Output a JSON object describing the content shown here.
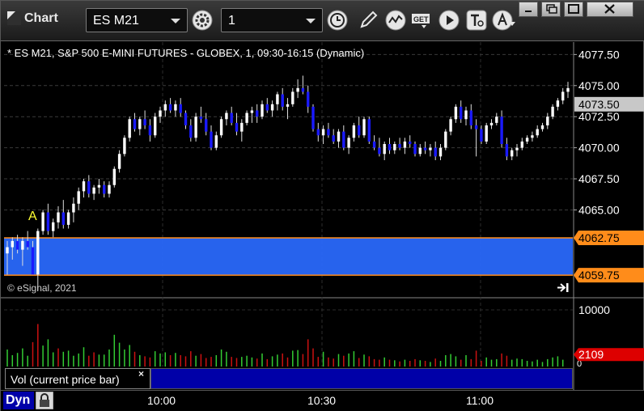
{
  "toolbar": {
    "title": "Chart",
    "symbol": "ES M21",
    "interval": "1",
    "icons": [
      "gear-icon",
      "clock-icon",
      "pencil-icon",
      "study-icon",
      "get-icon",
      "play-icon",
      "text-tool-icon",
      "alert-icon"
    ],
    "window_buttons": [
      "restore-icon",
      "maximize-icon",
      "close-icon"
    ]
  },
  "chart": {
    "title": "* ES M21, S&P 500 E-MINI FUTURES - GLOBEX, 1, 09:30-16:15 (Dynamic)",
    "watermark": "© eSignal, 2021",
    "marker_label": "A",
    "price_ticks": [
      "4077.50",
      "4075.00",
      "4072.50",
      "4070.00",
      "4067.50",
      "4065.00"
    ],
    "last_price": "4073.50",
    "band_high": "4062.75",
    "band_low": "4059.75",
    "volume_ticks": [
      "10000",
      "0"
    ],
    "volume_last": "2109",
    "volume_legend": "Vol (current price bar)",
    "time_labels": [
      "10:00",
      "10:30",
      "11:00"
    ],
    "dyn_label": "Dyn",
    "colors": {
      "up_candle": "#ffffff",
      "down_candle": "#1a1aff",
      "band_fill": "#2a6bff",
      "band_edge": "#ff8c1a",
      "vol_up": "#33cc33",
      "vol_down": "#cc1111",
      "last_price_bg": "#c8c8c8",
      "vol_last_bg": "#dd0000"
    }
  },
  "chart_data": {
    "type": "candlestick",
    "title": "* ES M21, S&P 500 E-MINI FUTURES - GLOBEX, 1, 09:30-16:15 (Dynamic)",
    "ylim": [
      4058.0,
      4078.5
    ],
    "x_ticks": [
      "10:00",
      "10:30",
      "11:00"
    ],
    "band": [
      4059.75,
      4062.75
    ],
    "candles": [
      [
        4061.5,
        4062.5,
        4059.8,
        4062.0
      ],
      [
        4062.0,
        4062.8,
        4061.0,
        4062.5
      ],
      [
        4062.5,
        4063.0,
        4061.5,
        4061.8
      ],
      [
        4061.8,
        4062.8,
        4060.5,
        4062.5
      ],
      [
        4062.5,
        4063.3,
        4061.8,
        4062.0
      ],
      [
        4062.0,
        4062.5,
        4059.8,
        4059.8
      ],
      [
        4059.8,
        4063.5,
        4058.5,
        4063.3
      ],
      [
        4063.3,
        4065.0,
        4063.0,
        4064.8
      ],
      [
        4064.8,
        4065.5,
        4063.0,
        4063.3
      ],
      [
        4063.3,
        4064.3,
        4062.8,
        4064.0
      ],
      [
        4064.0,
        4065.3,
        4063.5,
        4064.8
      ],
      [
        4064.8,
        4065.8,
        4063.5,
        4063.8
      ],
      [
        4063.8,
        4065.0,
        4063.5,
        4064.8
      ],
      [
        4064.8,
        4066.0,
        4064.0,
        4065.5
      ],
      [
        4065.5,
        4066.8,
        4065.0,
        4066.5
      ],
      [
        4066.5,
        4067.5,
        4066.0,
        4067.3
      ],
      [
        4067.3,
        4067.8,
        4066.0,
        4066.3
      ],
      [
        4066.3,
        4067.0,
        4065.8,
        4066.8
      ],
      [
        4066.8,
        4067.5,
        4066.3,
        4067.0
      ],
      [
        4067.0,
        4067.3,
        4066.0,
        4066.3
      ],
      [
        4066.3,
        4067.3,
        4066.0,
        4067.0
      ],
      [
        4067.0,
        4068.5,
        4066.8,
        4068.3
      ],
      [
        4068.3,
        4069.8,
        4068.0,
        4069.5
      ],
      [
        4069.5,
        4071.0,
        4069.3,
        4070.8
      ],
      [
        4070.8,
        4072.5,
        4070.5,
        4072.3
      ],
      [
        4072.3,
        4072.8,
        4071.3,
        4071.5
      ],
      [
        4071.5,
        4072.5,
        4071.0,
        4072.3
      ],
      [
        4072.3,
        4073.0,
        4071.5,
        4071.8
      ],
      [
        4071.8,
        4072.3,
        4070.5,
        4071.0
      ],
      [
        4071.0,
        4072.8,
        4070.8,
        4072.5
      ],
      [
        4072.5,
        4073.3,
        4072.0,
        4073.0
      ],
      [
        4073.0,
        4073.8,
        4072.5,
        4073.5
      ],
      [
        4073.5,
        4074.0,
        4072.8,
        4073.0
      ],
      [
        4073.0,
        4073.8,
        4072.5,
        4073.5
      ],
      [
        4073.5,
        4074.0,
        4072.5,
        4072.8
      ],
      [
        4072.8,
        4073.0,
        4071.5,
        4071.8
      ],
      [
        4071.8,
        4072.3,
        4070.5,
        4070.8
      ],
      [
        4070.8,
        4072.8,
        4070.5,
        4072.5
      ],
      [
        4072.5,
        4073.3,
        4072.0,
        4072.3
      ],
      [
        4072.3,
        4072.8,
        4071.0,
        4071.3
      ],
      [
        4071.3,
        4071.8,
        4069.8,
        4070.0
      ],
      [
        4070.0,
        4071.3,
        4069.8,
        4071.0
      ],
      [
        4071.0,
        4072.5,
        4070.8,
        4072.3
      ],
      [
        4072.3,
        4073.0,
        4071.8,
        4072.8
      ],
      [
        4072.8,
        4073.3,
        4071.8,
        4072.0
      ],
      [
        4072.0,
        4072.8,
        4071.0,
        4071.3
      ],
      [
        4071.3,
        4072.3,
        4070.5,
        4072.0
      ],
      [
        4072.0,
        4073.0,
        4071.8,
        4072.8
      ],
      [
        4072.8,
        4073.3,
        4072.0,
        4073.0
      ],
      [
        4073.0,
        4073.5,
        4072.0,
        4072.5
      ],
      [
        4072.5,
        4073.8,
        4072.3,
        4073.5
      ],
      [
        4073.5,
        4074.0,
        4072.8,
        4073.0
      ],
      [
        4073.0,
        4073.8,
        4072.5,
        4073.5
      ],
      [
        4073.5,
        4074.5,
        4073.0,
        4074.3
      ],
      [
        4074.3,
        4074.8,
        4073.0,
        4073.3
      ],
      [
        4073.3,
        4074.0,
        4072.3,
        4073.5
      ],
      [
        4073.5,
        4074.8,
        4073.3,
        4074.5
      ],
      [
        4074.5,
        4075.5,
        4074.0,
        4074.8
      ],
      [
        4074.8,
        4075.8,
        4074.3,
        4074.5
      ],
      [
        4074.5,
        4075.0,
        4072.8,
        4073.3
      ],
      [
        4073.3,
        4073.5,
        4071.3,
        4071.5
      ],
      [
        4071.5,
        4072.0,
        4070.5,
        4071.0
      ],
      [
        4071.0,
        4071.8,
        4070.3,
        4071.5
      ],
      [
        4071.5,
        4072.0,
        4070.8,
        4071.0
      ],
      [
        4071.0,
        4071.5,
        4070.3,
        4070.5
      ],
      [
        4070.5,
        4071.5,
        4070.0,
        4071.3
      ],
      [
        4071.3,
        4071.8,
        4069.8,
        4070.0
      ],
      [
        4070.0,
        4071.0,
        4069.5,
        4070.8
      ],
      [
        4070.8,
        4072.0,
        4070.5,
        4071.8
      ],
      [
        4071.8,
        4072.5,
        4070.8,
        4071.0
      ],
      [
        4071.0,
        4072.5,
        4070.8,
        4072.3
      ],
      [
        4072.3,
        4072.5,
        4070.3,
        4070.5
      ],
      [
        4070.5,
        4071.0,
        4069.8,
        4070.0
      ],
      [
        4070.0,
        4070.8,
        4069.3,
        4069.5
      ],
      [
        4069.5,
        4070.5,
        4069.0,
        4070.3
      ],
      [
        4070.3,
        4070.8,
        4069.5,
        4069.8
      ],
      [
        4069.8,
        4070.5,
        4069.5,
        4070.3
      ],
      [
        4070.3,
        4070.8,
        4069.8,
        4070.0
      ],
      [
        4070.0,
        4070.8,
        4069.5,
        4070.5
      ],
      [
        4070.5,
        4071.0,
        4070.0,
        4070.3
      ],
      [
        4070.3,
        4070.5,
        4069.3,
        4069.5
      ],
      [
        4069.5,
        4070.3,
        4069.3,
        4070.0
      ],
      [
        4070.0,
        4070.5,
        4069.5,
        4069.8
      ],
      [
        4069.8,
        4070.3,
        4069.3,
        4070.0
      ],
      [
        4070.0,
        4070.5,
        4069.0,
        4069.3
      ],
      [
        4069.3,
        4070.3,
        4069.0,
        4070.0
      ],
      [
        4070.0,
        4071.5,
        4069.8,
        4071.3
      ],
      [
        4071.3,
        4072.5,
        4071.0,
        4072.3
      ],
      [
        4072.3,
        4073.5,
        4072.0,
        4073.3
      ],
      [
        4073.3,
        4073.8,
        4072.0,
        4072.3
      ],
      [
        4072.3,
        4073.3,
        4071.8,
        4073.0
      ],
      [
        4073.0,
        4073.5,
        4071.5,
        4071.8
      ],
      [
        4071.8,
        4072.3,
        4069.3,
        4071.5
      ],
      [
        4071.5,
        4071.8,
        4070.3,
        4070.5
      ],
      [
        4070.5,
        4072.0,
        4070.3,
        4071.8
      ],
      [
        4071.8,
        4072.3,
        4071.5,
        4072.0
      ],
      [
        4072.0,
        4072.8,
        4071.8,
        4072.5
      ],
      [
        4072.5,
        4073.0,
        4070.0,
        4070.3
      ],
      [
        4070.3,
        4070.8,
        4069.0,
        4069.3
      ],
      [
        4069.3,
        4070.0,
        4069.0,
        4069.8
      ],
      [
        4069.8,
        4070.3,
        4069.3,
        4070.0
      ],
      [
        4070.0,
        4070.8,
        4069.8,
        4070.5
      ],
      [
        4070.5,
        4071.0,
        4070.3,
        4070.8
      ],
      [
        4070.8,
        4071.3,
        4070.5,
        4071.0
      ],
      [
        4071.0,
        4071.8,
        4070.8,
        4071.5
      ],
      [
        4071.5,
        4072.0,
        4071.3,
        4071.8
      ],
      [
        4071.8,
        4072.8,
        4071.5,
        4072.5
      ],
      [
        4072.5,
        4073.5,
        4072.3,
        4073.3
      ],
      [
        4073.3,
        4074.0,
        4073.0,
        4073.8
      ],
      [
        4073.8,
        4074.8,
        4073.5,
        4074.5
      ],
      [
        4074.5,
        4075.3,
        4074.0,
        4074.8
      ]
    ],
    "volume": [
      [
        3000,
        1
      ],
      [
        2000,
        1
      ],
      [
        2400,
        1
      ],
      [
        3200,
        1
      ],
      [
        1900,
        1
      ],
      [
        4300,
        0
      ],
      [
        7500,
        0
      ],
      [
        3700,
        1
      ],
      [
        4800,
        1
      ],
      [
        2500,
        1
      ],
      [
        3200,
        0
      ],
      [
        2600,
        1
      ],
      [
        2800,
        1
      ],
      [
        1900,
        1
      ],
      [
        2300,
        1
      ],
      [
        3400,
        1
      ],
      [
        1900,
        0
      ],
      [
        2500,
        0
      ],
      [
        2100,
        1
      ],
      [
        2100,
        1
      ],
      [
        3000,
        1
      ],
      [
        5600,
        1
      ],
      [
        4200,
        1
      ],
      [
        3000,
        1
      ],
      [
        3800,
        1
      ],
      [
        2600,
        0
      ],
      [
        2000,
        1
      ],
      [
        1800,
        0
      ],
      [
        1600,
        0
      ],
      [
        2700,
        1
      ],
      [
        2300,
        1
      ],
      [
        2500,
        1
      ],
      [
        2000,
        0
      ],
      [
        2400,
        1
      ],
      [
        2000,
        0
      ],
      [
        1800,
        0
      ],
      [
        2700,
        0
      ],
      [
        1900,
        1
      ],
      [
        2200,
        0
      ],
      [
        1500,
        0
      ],
      [
        1700,
        0
      ],
      [
        2000,
        1
      ],
      [
        3000,
        1
      ],
      [
        2600,
        1
      ],
      [
        1700,
        0
      ],
      [
        1500,
        0
      ],
      [
        1700,
        1
      ],
      [
        1900,
        1
      ],
      [
        1600,
        1
      ],
      [
        1400,
        0
      ],
      [
        2300,
        1
      ],
      [
        1300,
        0
      ],
      [
        1800,
        1
      ],
      [
        2100,
        1
      ],
      [
        2300,
        0
      ],
      [
        1600,
        0
      ],
      [
        2800,
        1
      ],
      [
        2900,
        1
      ],
      [
        2200,
        0
      ],
      [
        4800,
        0
      ],
      [
        3200,
        0
      ],
      [
        1700,
        0
      ],
      [
        2600,
        1
      ],
      [
        1600,
        0
      ],
      [
        1400,
        0
      ],
      [
        2200,
        1
      ],
      [
        1900,
        0
      ],
      [
        2300,
        1
      ],
      [
        2700,
        1
      ],
      [
        1500,
        0
      ],
      [
        2100,
        1
      ],
      [
        1800,
        0
      ],
      [
        1300,
        0
      ],
      [
        1200,
        0
      ],
      [
        1600,
        1
      ],
      [
        1200,
        0
      ],
      [
        1100,
        1
      ],
      [
        900,
        0
      ],
      [
        1200,
        1
      ],
      [
        1000,
        0
      ],
      [
        1300,
        0
      ],
      [
        1100,
        1
      ],
      [
        1000,
        0
      ],
      [
        800,
        1
      ],
      [
        1400,
        0
      ],
      [
        1000,
        1
      ],
      [
        2000,
        1
      ],
      [
        2200,
        1
      ],
      [
        1800,
        1
      ],
      [
        1200,
        0
      ],
      [
        2000,
        1
      ],
      [
        1300,
        0
      ],
      [
        2800,
        0
      ],
      [
        1000,
        0
      ],
      [
        1600,
        1
      ],
      [
        1200,
        1
      ],
      [
        1300,
        1
      ],
      [
        2300,
        0
      ],
      [
        1900,
        0
      ],
      [
        1200,
        1
      ],
      [
        1400,
        1
      ],
      [
        1300,
        1
      ],
      [
        1000,
        1
      ],
      [
        900,
        1
      ],
      [
        1200,
        1
      ],
      [
        800,
        1
      ],
      [
        1300,
        1
      ],
      [
        1600,
        1
      ],
      [
        1800,
        1
      ],
      [
        1200,
        1
      ]
    ]
  }
}
